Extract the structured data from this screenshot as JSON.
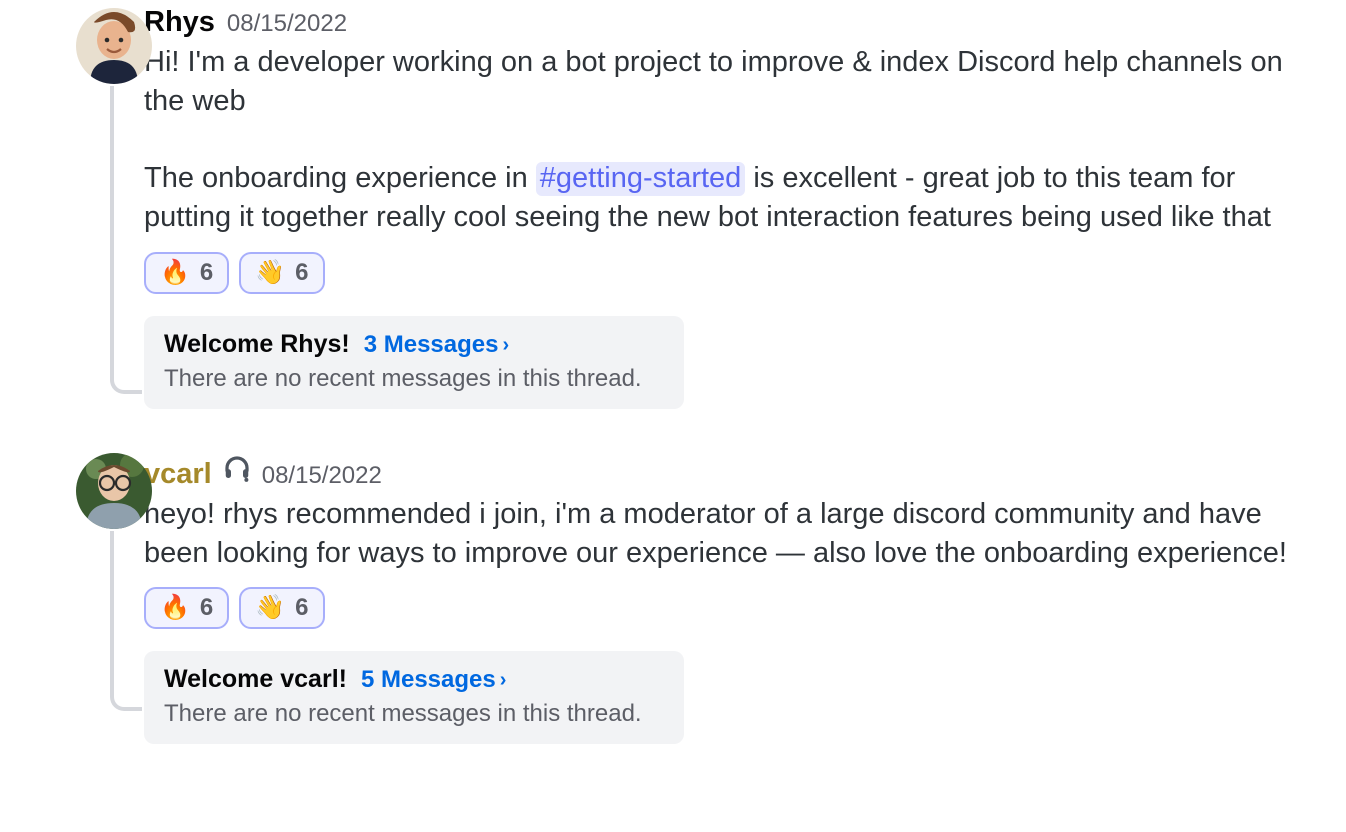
{
  "messages": [
    {
      "username": "Rhys",
      "username_color_class": "c0",
      "status_glyph": "",
      "timestamp": "08/15/2022",
      "para1_pre": "Hi! I'm a developer working on a bot project to improve & index Discord help channels on the web",
      "para2_pre": "The onboarding experience in ",
      "channel_mention": "#getting-started",
      "para2_post": " is excellent - great job to this team for putting it together really cool seeing the new bot interaction features being used like that",
      "reactions": [
        {
          "emoji": "🔥",
          "count": "6"
        },
        {
          "emoji": "👋",
          "count": "6"
        }
      ],
      "thread_title": "Welcome Rhys!",
      "thread_messages_label": "3 Messages",
      "thread_subtext": "There are no recent messages in this thread."
    },
    {
      "username": "vcarl",
      "username_color_class": "c1",
      "status_glyph": "headphones",
      "timestamp": "08/15/2022",
      "para1_pre": "heyo! rhys recommended i join, i'm a moderator of a large discord community and have been looking for ways to improve our experience — also love the onboarding experience!",
      "para2_pre": "",
      "channel_mention": "",
      "para2_post": "",
      "reactions": [
        {
          "emoji": "🔥",
          "count": "6"
        },
        {
          "emoji": "👋",
          "count": "6"
        }
      ],
      "thread_title": "Welcome vcarl!",
      "thread_messages_label": "5 Messages",
      "thread_subtext": "There are no recent messages in this thread."
    }
  ]
}
